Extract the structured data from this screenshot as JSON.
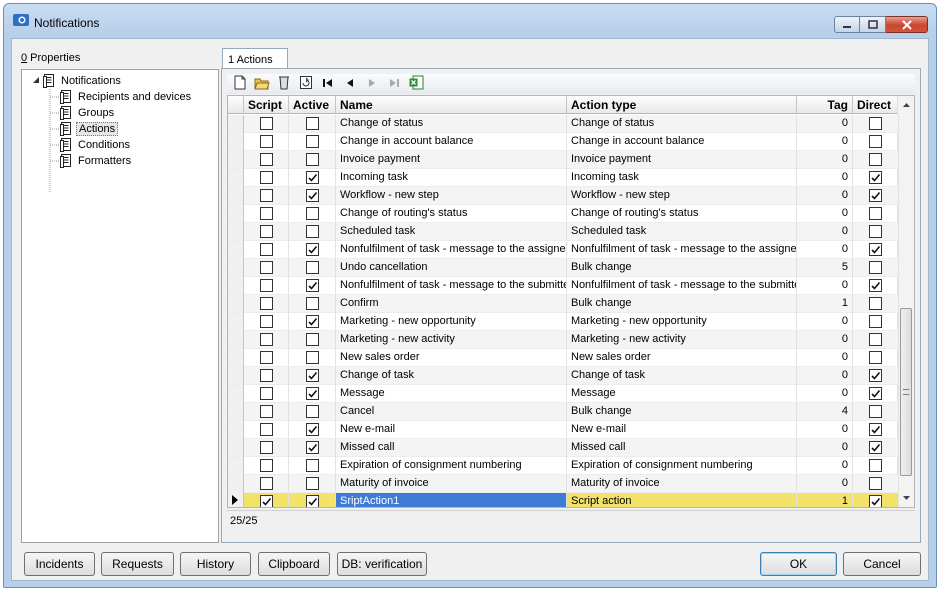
{
  "window": {
    "title": "Notifications"
  },
  "properties_label": {
    "hotkey": "0",
    "text": " Properties"
  },
  "tree": [
    {
      "label": "Notifications",
      "level": 0,
      "expander": true,
      "selected": false
    },
    {
      "label": "Recipients and devices",
      "level": 1,
      "selected": false
    },
    {
      "label": "Groups",
      "level": 1,
      "selected": false
    },
    {
      "label": "Actions",
      "level": 1,
      "selected": true
    },
    {
      "label": "Conditions",
      "level": 1,
      "selected": false
    },
    {
      "label": "Formatters",
      "level": 1,
      "selected": false
    }
  ],
  "tab": {
    "label": "1 Actions"
  },
  "toolbar_icons": [
    "new-icon",
    "open-folder-icon",
    "delete-icon",
    "refresh-icon",
    "first-record-icon",
    "previous-record-icon",
    "next-record-icon",
    "last-record-icon",
    "excel-export-icon"
  ],
  "grid": {
    "columns": [
      "Script",
      "Active",
      "Name",
      "Action type",
      "Tag",
      "Direct"
    ],
    "rows": [
      {
        "script": false,
        "active": false,
        "name": "Change of status",
        "type": "Change of status",
        "tag": "0",
        "direct": false
      },
      {
        "script": false,
        "active": false,
        "name": "Change in account balance",
        "type": "Change in account balance",
        "tag": "0",
        "direct": false
      },
      {
        "script": false,
        "active": false,
        "name": "Invoice payment",
        "type": "Invoice payment",
        "tag": "0",
        "direct": false
      },
      {
        "script": false,
        "active": true,
        "name": "Incoming task",
        "type": "Incoming task",
        "tag": "0",
        "direct": true
      },
      {
        "script": false,
        "active": true,
        "name": "Workflow - new step",
        "type": "Workflow - new step",
        "tag": "0",
        "direct": true
      },
      {
        "script": false,
        "active": false,
        "name": "Change of routing's status",
        "type": "Change of routing's status",
        "tag": "0",
        "direct": false
      },
      {
        "script": false,
        "active": false,
        "name": "Scheduled task",
        "type": "Scheduled task",
        "tag": "0",
        "direct": false
      },
      {
        "script": false,
        "active": true,
        "name": "Nonfulfilment of task - message to the assignee",
        "type": "Nonfulfilment of task - message to the assignee",
        "tag": "0",
        "direct": true
      },
      {
        "script": false,
        "active": false,
        "name": "Undo cancellation",
        "type": "Bulk change",
        "tag": "5",
        "direct": false
      },
      {
        "script": false,
        "active": true,
        "name": "Nonfulfilment of task - message to the submitte",
        "type": "Nonfulfilment of task - message to the submitte",
        "tag": "0",
        "direct": true
      },
      {
        "script": false,
        "active": false,
        "name": "Confirm",
        "type": "Bulk change",
        "tag": "1",
        "direct": false
      },
      {
        "script": false,
        "active": true,
        "name": "Marketing - new opportunity",
        "type": "Marketing - new opportunity",
        "tag": "0",
        "direct": false
      },
      {
        "script": false,
        "active": false,
        "name": "Marketing - new activity",
        "type": "Marketing - new activity",
        "tag": "0",
        "direct": false
      },
      {
        "script": false,
        "active": false,
        "name": "New sales order",
        "type": "New sales order",
        "tag": "0",
        "direct": false
      },
      {
        "script": false,
        "active": true,
        "name": "Change of task",
        "type": "Change of task",
        "tag": "0",
        "direct": true
      },
      {
        "script": false,
        "active": true,
        "name": "Message",
        "type": "Message",
        "tag": "0",
        "direct": true
      },
      {
        "script": false,
        "active": false,
        "name": "Cancel",
        "type": "Bulk change",
        "tag": "4",
        "direct": false
      },
      {
        "script": false,
        "active": true,
        "name": "New e-mail",
        "type": "New e-mail",
        "tag": "0",
        "direct": true
      },
      {
        "script": false,
        "active": true,
        "name": "Missed call",
        "type": "Missed call",
        "tag": "0",
        "direct": true
      },
      {
        "script": false,
        "active": false,
        "name": "Expiration of consignment numbering",
        "type": "Expiration of consignment numbering",
        "tag": "0",
        "direct": false
      },
      {
        "script": false,
        "active": false,
        "name": "Maturity of invoice",
        "type": "Maturity of invoice",
        "tag": "0",
        "direct": false
      },
      {
        "script": true,
        "active": true,
        "name": "SriptAction1",
        "type": "Script action",
        "tag": "1",
        "direct": true,
        "selected": true
      }
    ]
  },
  "status": {
    "record_count": "25/25"
  },
  "buttons": {
    "incidents": "Incidents",
    "requests": "Requests",
    "history": "History",
    "clipboard": "Clipboard",
    "db": "DB: verification",
    "ok": "OK",
    "cancel": "Cancel"
  },
  "colors": {
    "selected_row": "#f2e26a",
    "selected_cell": "#3d7bd6"
  }
}
